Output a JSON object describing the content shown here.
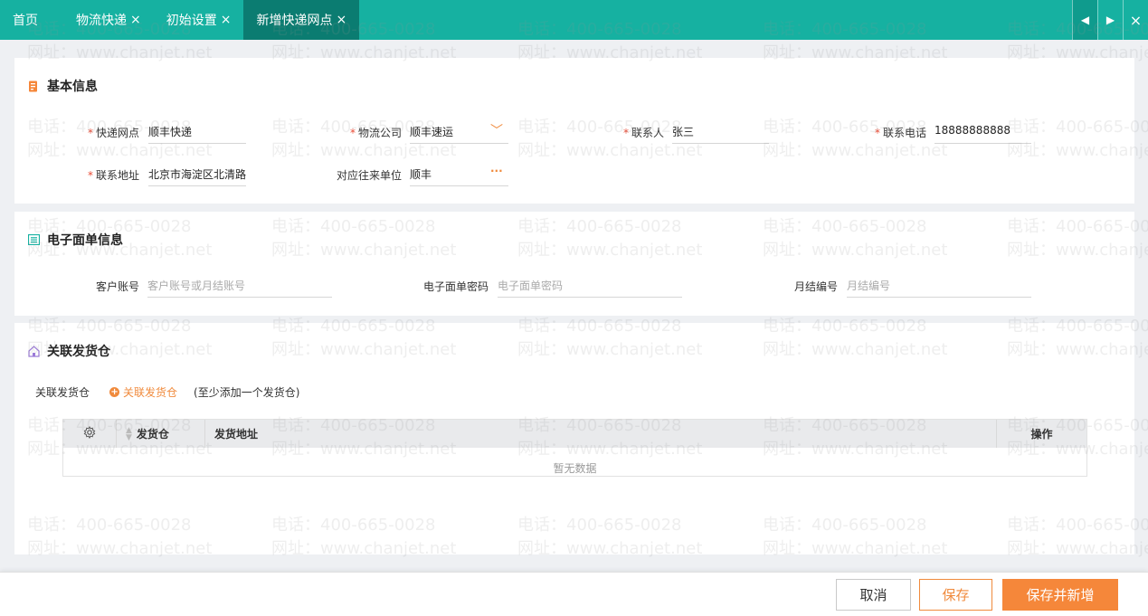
{
  "tabs": [
    {
      "label": "首页",
      "closable": false
    },
    {
      "label": "物流快递",
      "closable": true
    },
    {
      "label": "初始设置",
      "closable": true
    },
    {
      "label": "新增快递网点",
      "closable": true,
      "active": true
    }
  ],
  "tab_close_glyph": "×",
  "tab_nav": {
    "prev": "◀",
    "next": "▶",
    "close": "×"
  },
  "basic": {
    "title": "基本信息",
    "express_point": {
      "label": "快递网点",
      "value": "顺丰快递"
    },
    "logistics_company": {
      "label": "物流公司",
      "value": "顺丰速运",
      "dropdown_glyph": "﹀"
    },
    "contact": {
      "label": "联系人",
      "value": "张三"
    },
    "phone": {
      "label": "联系电话",
      "value": "18888888888"
    },
    "address": {
      "label": "联系地址",
      "value": "北京市海淀区北清路("
    },
    "partner": {
      "label": "对应往来单位",
      "value": "顺丰",
      "more_glyph": "···"
    }
  },
  "ewaybill": {
    "title": "电子面单信息",
    "account": {
      "label": "客户账号",
      "placeholder": "客户账号或月结账号"
    },
    "password": {
      "label": "电子面单密码",
      "placeholder": "电子面单密码"
    },
    "monthly_no": {
      "label": "月结编号",
      "placeholder": "月结编号"
    }
  },
  "warehouse": {
    "title": "关联发货仓",
    "row_label": "关联发货仓",
    "add_label": "关联发货仓",
    "hint": "(至少添加一个发货仓)",
    "columns": {
      "warehouse": "发货仓",
      "address": "发货地址",
      "operation": "操作"
    },
    "empty_text": "暂无数据"
  },
  "footer": {
    "cancel": "取消",
    "save": "保存",
    "save_new": "保存并新增"
  },
  "watermark": {
    "phone": "电话：400-665-0028",
    "site": "网址：www.chanjet.net"
  },
  "colors": {
    "tab_bar": "#16b1a1",
    "tab_active": "#0b7c71",
    "accent": "#f5873a",
    "required": "#e94b35"
  }
}
